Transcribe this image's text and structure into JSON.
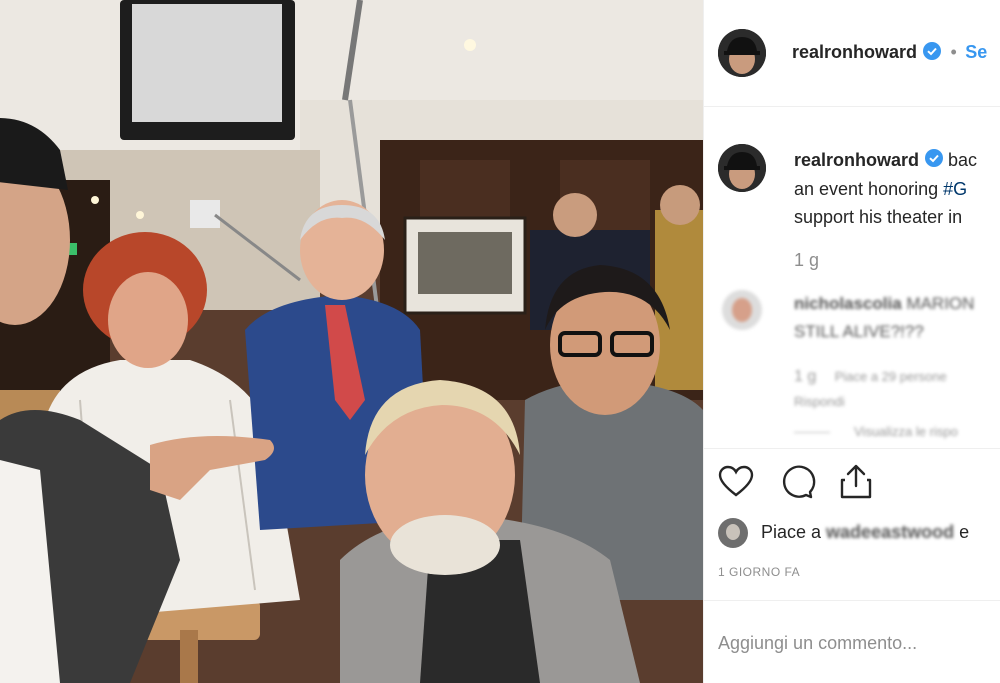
{
  "post": {
    "username": "realronhoward",
    "follow_label": "Se",
    "follow_sep": "•"
  },
  "caption": {
    "username": "realronhoward",
    "text_1": " bac",
    "text_2": "an event honoring ",
    "hashtag": "#G",
    "text_3": "support his theater in",
    "time": "1 g"
  },
  "comments": [
    {
      "username": "nicholascolia",
      "text_1": " MARION",
      "text_2": "STILL ALIVE?!??",
      "time": "1 g",
      "likes": "Piace a 29 persone",
      "reply": "Rispondi",
      "view_replies": "Visualizza le rispo"
    }
  ],
  "likes": {
    "prefix": "Piace a ",
    "user": "wadeeastwood",
    "suffix": " e"
  },
  "date": "1 GIORNO FA",
  "add_comment_placeholder": "Aggiungi un commento...",
  "colors": {
    "accent": "#3897f0",
    "text": "#262626",
    "muted": "#8e8e8e",
    "hashtag": "#00376b"
  },
  "icons": [
    "heart-icon",
    "comment-icon",
    "share-icon",
    "verified-badge-icon"
  ]
}
